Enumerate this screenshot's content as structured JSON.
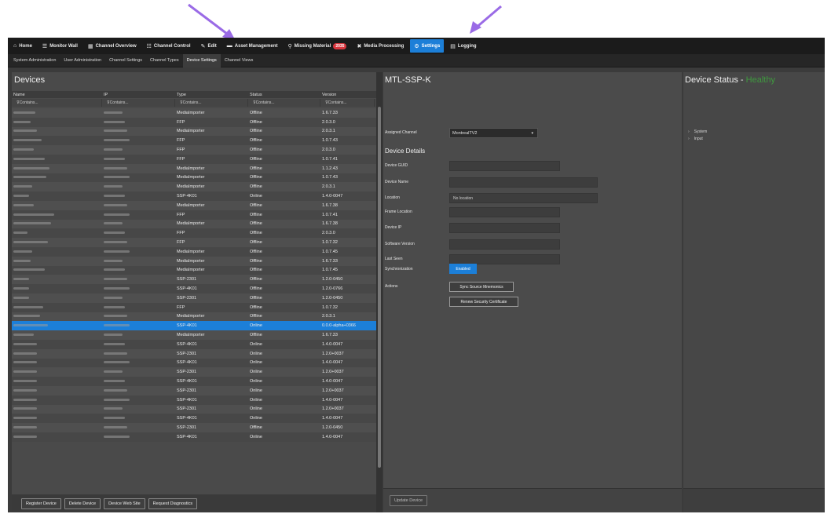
{
  "colors": {
    "accent": "#1c7fd8",
    "healthy": "#3f9a3f",
    "annotation_arrow": "#9a6be6",
    "error_badge": "#d9363e"
  },
  "topnav": [
    {
      "label": "Home",
      "icon": "home-icon",
      "glyph": "⌂"
    },
    {
      "label": "Monitor Wall",
      "icon": "monitor-wall-icon",
      "glyph": "☰"
    },
    {
      "label": "Channel Overview",
      "icon": "channel-overview-icon",
      "glyph": "▦"
    },
    {
      "label": "Channel Control",
      "icon": "channel-control-icon",
      "glyph": "☷"
    },
    {
      "label": "Edit",
      "icon": "edit-icon",
      "glyph": "✎"
    },
    {
      "label": "Asset Management",
      "icon": "folder-icon",
      "glyph": "▬"
    },
    {
      "label": "Missing Material",
      "icon": "search-icon",
      "glyph": "⚲",
      "badge": "2035"
    },
    {
      "label": "Media Processing",
      "icon": "media-processing-icon",
      "glyph": "✖"
    },
    {
      "label": "Settings",
      "icon": "gear-icon",
      "glyph": "⚙",
      "active": true
    },
    {
      "label": "Logging",
      "icon": "logging-icon",
      "glyph": "▤"
    }
  ],
  "subnav": [
    "System Administration",
    "User Administration",
    "Channel Settings",
    "Channel Types",
    "Device Settings",
    "Channel Views"
  ],
  "subnav_active": "Device Settings",
  "devices": {
    "title": "Devices",
    "columns": [
      "Name",
      "IP",
      "Type",
      "Status",
      "Version"
    ],
    "filter_placeholder": "Contains...",
    "rows": [
      {
        "type": "MediaImporter",
        "status": "Offline",
        "version": "1.6.7.33"
      },
      {
        "type": "FFP",
        "status": "Offline",
        "version": "2.0.3.0"
      },
      {
        "type": "MediaImporter",
        "status": "Offline",
        "version": "2.0.3.1"
      },
      {
        "type": "FFP",
        "status": "Offline",
        "version": "1.0.7.43"
      },
      {
        "type": "FFP",
        "status": "Offline",
        "version": "2.0.3.0"
      },
      {
        "type": "FFP",
        "status": "Offline",
        "version": "1.0.7.41"
      },
      {
        "type": "MediaImporter",
        "status": "Offline",
        "version": "1.1.2.43"
      },
      {
        "type": "MediaImporter",
        "status": "Offline",
        "version": "1.0.7.43"
      },
      {
        "type": "MediaImporter",
        "status": "Offline",
        "version": "2.0.3.1"
      },
      {
        "type": "SSP-4K01",
        "status": "Online",
        "version": "1.4.0-0047"
      },
      {
        "type": "MediaImporter",
        "status": "Offline",
        "version": "1.6.7.38"
      },
      {
        "type": "FFP",
        "status": "Offline",
        "version": "1.0.7.41"
      },
      {
        "type": "MediaImporter",
        "status": "Offline",
        "version": "1.6.7.38"
      },
      {
        "type": "FFP",
        "status": "Offline",
        "version": "2.0.3.0"
      },
      {
        "type": "FFP",
        "status": "Offline",
        "version": "1.0.7.32"
      },
      {
        "type": "MediaImporter",
        "status": "Offline",
        "version": "1.0.7.45"
      },
      {
        "type": "MediaImporter",
        "status": "Offline",
        "version": "1.6.7.33"
      },
      {
        "type": "MediaImporter",
        "status": "Offline",
        "version": "1.0.7.45"
      },
      {
        "type": "SSP-2301",
        "status": "Offline",
        "version": "1.2.0-0450"
      },
      {
        "type": "SSP-4K01",
        "status": "Offline",
        "version": "1.2.0-0766"
      },
      {
        "type": "SSP-2301",
        "status": "Offline",
        "version": "1.2.0-0450"
      },
      {
        "type": "FFP",
        "status": "Offline",
        "version": "1.0.7.32"
      },
      {
        "type": "MediaImporter",
        "status": "Offline",
        "version": "2.0.3.1"
      },
      {
        "type": "SSP-4K01",
        "status": "Online",
        "version": "0.0.0-alpha+0366",
        "selected": true
      },
      {
        "type": "MediaImporter",
        "status": "Offline",
        "version": "1.6.7.33"
      },
      {
        "type": "SSP-4K01",
        "status": "Online",
        "version": "1.4.0-0047"
      },
      {
        "type": "SSP-2301",
        "status": "Online",
        "version": "1.2.0+0037"
      },
      {
        "type": "SSP-4K01",
        "status": "Online",
        "version": "1.4.0-0047"
      },
      {
        "type": "SSP-2301",
        "status": "Online",
        "version": "1.2.0+0037"
      },
      {
        "type": "SSP-4K01",
        "status": "Online",
        "version": "1.4.0-0047"
      },
      {
        "type": "SSP-2301",
        "status": "Online",
        "version": "1.2.0+0037"
      },
      {
        "type": "SSP-4K01",
        "status": "Online",
        "version": "1.4.0-0047"
      },
      {
        "type": "SSP-2301",
        "status": "Online",
        "version": "1.2.0+0037"
      },
      {
        "type": "SSP-4K01",
        "status": "Online",
        "version": "1.4.0-0047"
      },
      {
        "type": "SSP-2301",
        "status": "Offline",
        "version": "1.2.0-0450"
      },
      {
        "type": "SSP-4K01",
        "status": "Online",
        "version": "1.4.0-0047"
      }
    ],
    "buttons": [
      "Register Device",
      "Delete Device",
      "Device Web Site",
      "Request Diagnostics"
    ]
  },
  "detail": {
    "title": "MTL-SSP-K",
    "assigned_channel_label": "Assigned Channel",
    "assigned_channel_value": "MontrealTV2",
    "section_title": "Device Details",
    "fields": [
      {
        "label": "Device GUID",
        "value": ""
      },
      {
        "label": "Device Name",
        "value": ""
      },
      {
        "label": "Location",
        "value": "No location"
      },
      {
        "label": "Frame Location",
        "value": ""
      },
      {
        "label": "Device IP",
        "value": ""
      },
      {
        "label": "Software Version",
        "value": ""
      },
      {
        "label": "Last Seen",
        "value": ""
      }
    ],
    "sync_label": "Synchronization",
    "sync_value": "Enabled",
    "actions_label": "Actions",
    "actions": [
      "Sync Source Mnemonics",
      "Renew Security Certificate"
    ],
    "update_button": "Update Device"
  },
  "status": {
    "title": "Device Status -",
    "health": "Healthy",
    "items": [
      "System",
      "Input"
    ]
  }
}
